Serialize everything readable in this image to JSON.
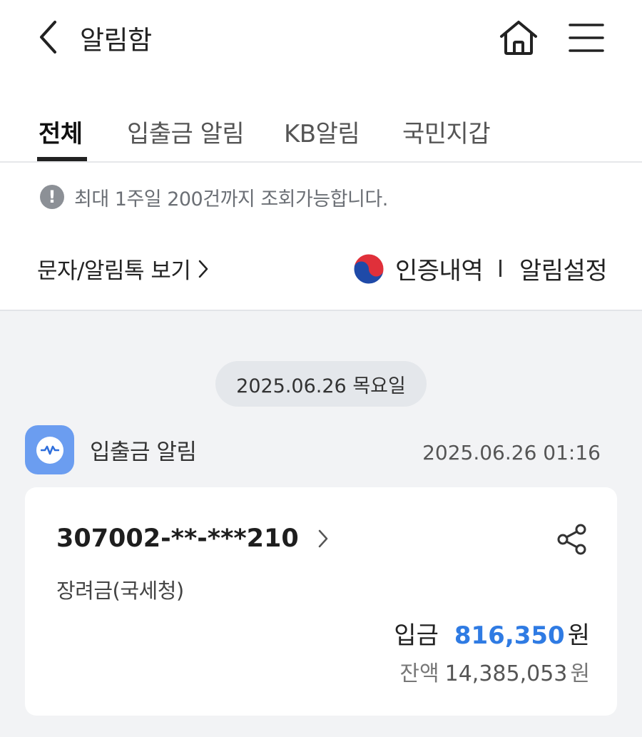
{
  "header": {
    "title": "알림함",
    "back_icon": "chevron-left-icon",
    "home_icon": "home-icon",
    "menu_icon": "hamburger-menu-icon"
  },
  "tabs": [
    {
      "label": "전체",
      "active": true
    },
    {
      "label": "입출금 알림",
      "active": false
    },
    {
      "label": "KB알림",
      "active": false
    },
    {
      "label": "국민지갑",
      "active": false
    }
  ],
  "notice": {
    "icon": "!",
    "text": "최대 1주일 200건까지 조회가능합니다."
  },
  "links": {
    "sms_label": "문자/알림톡 보기",
    "cert_label": "인증내역",
    "setting_label": "알림설정"
  },
  "date_header": "2025.06.26 목요일",
  "notification": {
    "source": "입출금 알림",
    "timestamp": "2025.06.26 01:16",
    "account": "307002-**-***210",
    "memo": "장려금(국세청)",
    "deposit_label": "입금",
    "deposit_amount": "816,350",
    "deposit_unit": "원",
    "balance_label": "잔액",
    "balance_amount": "14,385,053",
    "balance_unit": "원"
  },
  "colors": {
    "accent_blue": "#2f7be3",
    "app_icon_bg": "#6b9df0",
    "background": "#f2f3f5"
  }
}
